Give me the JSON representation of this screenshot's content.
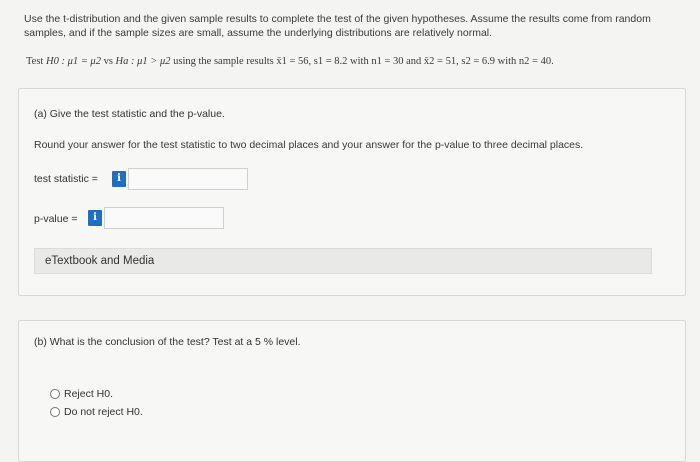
{
  "intro": "Use the t-distribution and the given sample results to complete the test of the given hypotheses. Assume the results come from random samples, and if the sample sizes are small, assume the underlying distributions are relatively normal.",
  "hypothesis": {
    "prefix": "Test",
    "h0": "H0 : μ1 = μ2",
    "vs": "vs",
    "ha": "Ha : μ1 > μ2",
    "sample_text": "using the sample results x̄1 = 56, s1 = 8.2 with n1 = 30 and x̄2 = 51, s2 = 6.9 with n2 = 40."
  },
  "part_a": {
    "label": "(a) Give the test statistic and the p-value.",
    "instruction": "Round your answer for the test statistic to two decimal places and your answer for the p-value to three decimal places.",
    "test_statistic_label": "test statistic =",
    "p_value_label": "p-value =",
    "info_glyph": "i",
    "test_statistic_value": "",
    "p_value_value": "",
    "etextbook": "eTextbook and Media"
  },
  "part_b": {
    "label": "(b) What is the conclusion of the test? Test at a 5 % level.",
    "options": [
      "Reject H0.",
      "Do not reject H0."
    ]
  }
}
